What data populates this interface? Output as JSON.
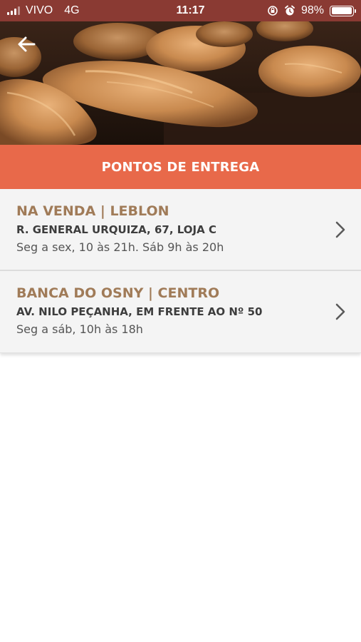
{
  "status_bar": {
    "carrier": "VIVO",
    "network": "4G",
    "time": "11:17",
    "battery": "98%",
    "battery_level": 0.98,
    "icons": [
      "signal-icon",
      "orientation-lock-icon",
      "alarm-icon",
      "battery-icon"
    ]
  },
  "hero": {
    "image": "bread-loaves-photo",
    "back_icon": "arrow-left-icon"
  },
  "header": {
    "title": "PONTOS DE ENTREGA"
  },
  "locations": [
    {
      "title": "NA VENDA | LEBLON",
      "address": "R. GENERAL URQUIZA, 67, LOJA C",
      "hours": "Seg a sex, 10 às 21h. Sáb 9h às 20h",
      "icon": "chevron-right-icon"
    },
    {
      "title": "BANCA DO OSNY | CENTRO",
      "address": "AV. NILO PEÇANHA, EM FRENTE AO Nº 50",
      "hours": "Seg a sáb, 10h às 18h",
      "icon": "chevron-right-icon"
    }
  ],
  "colors": {
    "status_bar": "#8a3a33",
    "header": "#e8694a",
    "title_text": "#a07b58",
    "list_bg": "#f4f4f4"
  }
}
